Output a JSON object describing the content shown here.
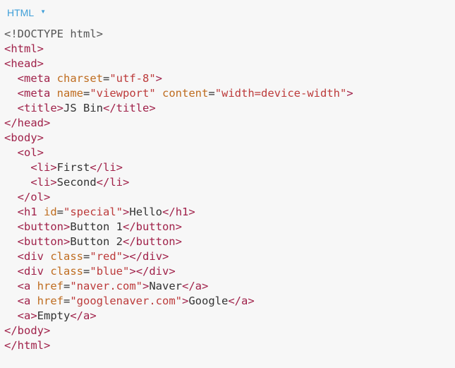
{
  "header": {
    "language": "HTML",
    "caret": "▼"
  },
  "colors": {
    "background": "#f7f7f7",
    "accent": "#3f9fd8",
    "tag": "#a0224a",
    "attribute": "#bf6c1f",
    "string": "#bc3a3a",
    "text": "#333333",
    "active_line": "#e8f2ff"
  },
  "editor": {
    "active_line": 23,
    "lines": [
      [
        {
          "t": "meta",
          "v": "<!DOCTYPE html>"
        }
      ],
      [
        {
          "t": "tag",
          "v": "<html>"
        }
      ],
      [
        {
          "t": "tag",
          "v": "<head>"
        }
      ],
      [
        {
          "t": "txt",
          "v": "  "
        },
        {
          "t": "tag",
          "v": "<meta "
        },
        {
          "t": "attr",
          "v": "charset"
        },
        {
          "t": "txt",
          "v": "="
        },
        {
          "t": "val",
          "v": "\"utf-8\""
        },
        {
          "t": "tag",
          "v": ">"
        }
      ],
      [
        {
          "t": "txt",
          "v": "  "
        },
        {
          "t": "tag",
          "v": "<meta "
        },
        {
          "t": "attr",
          "v": "name"
        },
        {
          "t": "txt",
          "v": "="
        },
        {
          "t": "val",
          "v": "\"viewport\""
        },
        {
          "t": "txt",
          "v": " "
        },
        {
          "t": "attr",
          "v": "content"
        },
        {
          "t": "txt",
          "v": "="
        },
        {
          "t": "val",
          "v": "\"width=device-width\""
        },
        {
          "t": "tag",
          "v": ">"
        }
      ],
      [
        {
          "t": "txt",
          "v": "  "
        },
        {
          "t": "tag",
          "v": "<title>"
        },
        {
          "t": "txt",
          "v": "JS Bin"
        },
        {
          "t": "tag",
          "v": "</title>"
        }
      ],
      [
        {
          "t": "tag",
          "v": "</head>"
        }
      ],
      [
        {
          "t": "tag",
          "v": "<body>"
        }
      ],
      [
        {
          "t": "txt",
          "v": "  "
        },
        {
          "t": "tag",
          "v": "<ol>"
        }
      ],
      [
        {
          "t": "txt",
          "v": "    "
        },
        {
          "t": "tag",
          "v": "<li>"
        },
        {
          "t": "txt",
          "v": "First"
        },
        {
          "t": "tag",
          "v": "</li>"
        }
      ],
      [
        {
          "t": "txt",
          "v": "    "
        },
        {
          "t": "tag",
          "v": "<li>"
        },
        {
          "t": "txt",
          "v": "Second"
        },
        {
          "t": "tag",
          "v": "</li>"
        }
      ],
      [
        {
          "t": "txt",
          "v": "  "
        },
        {
          "t": "tag",
          "v": "</ol>"
        }
      ],
      [
        {
          "t": "txt",
          "v": "  "
        },
        {
          "t": "tag",
          "v": "<h1 "
        },
        {
          "t": "attr",
          "v": "id"
        },
        {
          "t": "txt",
          "v": "="
        },
        {
          "t": "val",
          "v": "\"special\""
        },
        {
          "t": "tag",
          "v": ">"
        },
        {
          "t": "txt",
          "v": "Hello"
        },
        {
          "t": "tag",
          "v": "</h1>"
        }
      ],
      [
        {
          "t": "txt",
          "v": "  "
        },
        {
          "t": "tag",
          "v": "<button>"
        },
        {
          "t": "txt",
          "v": "Button 1"
        },
        {
          "t": "tag",
          "v": "</button>"
        }
      ],
      [
        {
          "t": "txt",
          "v": "  "
        },
        {
          "t": "tag",
          "v": "<button>"
        },
        {
          "t": "txt",
          "v": "Button 2"
        },
        {
          "t": "tag",
          "v": "</button>"
        }
      ],
      [
        {
          "t": "txt",
          "v": "  "
        },
        {
          "t": "tag",
          "v": "<div "
        },
        {
          "t": "attr",
          "v": "class"
        },
        {
          "t": "txt",
          "v": "="
        },
        {
          "t": "val",
          "v": "\"red\""
        },
        {
          "t": "tag",
          "v": "></div>"
        }
      ],
      [
        {
          "t": "txt",
          "v": "  "
        },
        {
          "t": "tag",
          "v": "<div "
        },
        {
          "t": "attr",
          "v": "class"
        },
        {
          "t": "txt",
          "v": "="
        },
        {
          "t": "val",
          "v": "\"blue\""
        },
        {
          "t": "tag",
          "v": "></div>"
        }
      ],
      [
        {
          "t": "txt",
          "v": "  "
        },
        {
          "t": "tag",
          "v": "<a "
        },
        {
          "t": "attr",
          "v": "href"
        },
        {
          "t": "txt",
          "v": "="
        },
        {
          "t": "val",
          "v": "\"naver.com\""
        },
        {
          "t": "tag",
          "v": ">"
        },
        {
          "t": "txt",
          "v": "Naver"
        },
        {
          "t": "tag",
          "v": "</a>"
        }
      ],
      [
        {
          "t": "txt",
          "v": "  "
        },
        {
          "t": "tag",
          "v": "<a "
        },
        {
          "t": "attr",
          "v": "href"
        },
        {
          "t": "txt",
          "v": "="
        },
        {
          "t": "val",
          "v": "\"googlenaver.com\""
        },
        {
          "t": "tag",
          "v": ">"
        },
        {
          "t": "txt",
          "v": "Google"
        },
        {
          "t": "tag",
          "v": "</a>"
        }
      ],
      [
        {
          "t": "txt",
          "v": "  "
        },
        {
          "t": "tag",
          "v": "<a>"
        },
        {
          "t": "txt",
          "v": "Empty"
        },
        {
          "t": "tag",
          "v": "</a>"
        }
      ],
      [
        {
          "t": "tag",
          "v": "</body>"
        }
      ],
      [
        {
          "t": "tag",
          "v": "</html>"
        }
      ]
    ]
  }
}
